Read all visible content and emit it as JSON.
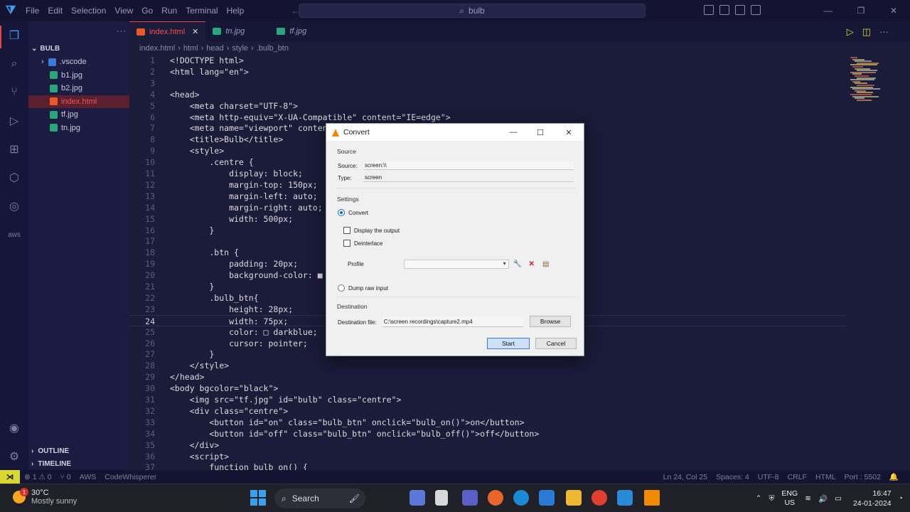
{
  "titlebar": {
    "menu": [
      "File",
      "Edit",
      "Selection",
      "View",
      "Go",
      "Run",
      "Terminal",
      "Help"
    ],
    "search_text": "bulb"
  },
  "sidebar": {
    "folder": "BULB",
    "items": [
      {
        "label": ".vscode",
        "type": "folder"
      },
      {
        "label": "b1.jpg",
        "type": "image"
      },
      {
        "label": "b2.jpg",
        "type": "image"
      },
      {
        "label": "index.html",
        "type": "html",
        "active": true
      },
      {
        "label": "tf.jpg",
        "type": "image"
      },
      {
        "label": "tn.jpg",
        "type": "image"
      }
    ],
    "outline": "OUTLINE",
    "timeline": "TIMELINE"
  },
  "tabs": [
    {
      "label": "index.html",
      "active": true
    },
    {
      "label": "tn.jpg",
      "active": false
    },
    {
      "label": "tf.jpg",
      "active": false
    }
  ],
  "breadcrumb": [
    "index.html",
    "html",
    "head",
    "style",
    ".bulb_btn"
  ],
  "editor": {
    "current_line": 24,
    "lines": [
      {
        "n": "1",
        "t": "<!DOCTYPE html>"
      },
      {
        "n": "2",
        "t": "<html lang=\"en\">"
      },
      {
        "n": "3",
        "t": ""
      },
      {
        "n": "4",
        "t": "<head>"
      },
      {
        "n": "5",
        "t": "    <meta charset=\"UTF-8\">"
      },
      {
        "n": "6",
        "t": "    <meta http-equiv=\"X-UA-Compatible\" content=\"IE=edge\">"
      },
      {
        "n": "7",
        "t": "    <meta name=\"viewport\" content="
      },
      {
        "n": "8",
        "t": "    <title>Bulb</title>"
      },
      {
        "n": "9",
        "t": "    <style>"
      },
      {
        "n": "10",
        "t": "        .centre {"
      },
      {
        "n": "11",
        "t": "            display: block;"
      },
      {
        "n": "12",
        "t": "            margin-top: 150px;"
      },
      {
        "n": "13",
        "t": "            margin-left: auto;"
      },
      {
        "n": "14",
        "t": "            margin-right: auto;"
      },
      {
        "n": "15",
        "t": "            width: 500px;"
      },
      {
        "n": "16",
        "t": "        }"
      },
      {
        "n": "17",
        "t": ""
      },
      {
        "n": "18",
        "t": "        .btn {"
      },
      {
        "n": "19",
        "t": "            padding: 20px;"
      },
      {
        "n": "20",
        "t": "            background-color: ■ gr"
      },
      {
        "n": "21",
        "t": "        }"
      },
      {
        "n": "22",
        "t": "        .bulb_btn{"
      },
      {
        "n": "23",
        "t": "            height: 28px;"
      },
      {
        "n": "24",
        "t": "            width: 75px;"
      },
      {
        "n": "25",
        "t": "            color: □ darkblue;"
      },
      {
        "n": "26",
        "t": "            cursor: pointer;"
      },
      {
        "n": "27",
        "t": "        }"
      },
      {
        "n": "28",
        "t": "    </style>"
      },
      {
        "n": "29",
        "t": "</head>"
      },
      {
        "n": "30",
        "t": "<body bgcolor=\"black\">"
      },
      {
        "n": "31",
        "t": "    <img src=\"tf.jpg\" id=\"bulb\" class=\"centre\">"
      },
      {
        "n": "32",
        "t": "    <div class=\"centre\">"
      },
      {
        "n": "33",
        "t": "        <button id=\"on\" class=\"bulb_btn\" onclick=\"bulb_on()\">on</button>"
      },
      {
        "n": "34",
        "t": "        <button id=\"off\" class=\"bulb_btn\" onclick=\"bulb_off()\">off</button>"
      },
      {
        "n": "35",
        "t": "    </div>"
      },
      {
        "n": "36",
        "t": "    <script>"
      },
      {
        "n": "37",
        "t": "        function bulb_on() {"
      }
    ]
  },
  "statusbar": {
    "left": [
      "⊗ 1 ⚠ 0",
      "⑂ 0",
      "AWS",
      "CodeWhisperer"
    ],
    "right": [
      "Ln 24, Col 25",
      "Spaces: 4",
      "UTF-8",
      "CRLF",
      "HTML",
      "Port : 5502"
    ]
  },
  "dialog": {
    "title": "Convert",
    "source_section": "Source",
    "source_label": "Source:",
    "source_value": "screen:\\\\",
    "type_label": "Type:",
    "type_value": "screen",
    "settings_section": "Settings",
    "convert_option": "Convert",
    "display_output": "Display the output",
    "deinterlace": "Deinterlace",
    "profile_label": "Profile",
    "dump_raw": "Dump raw input",
    "destination_section": "Destination",
    "destination_label": "Destination file:",
    "destination_value": "C:\\screen recordings\\capture2.mp4",
    "browse": "Browse",
    "start": "Start",
    "cancel": "Cancel"
  },
  "taskbar": {
    "weather_temp": "30°C",
    "weather_desc": "Mostly sunny",
    "weather_badge": "1",
    "search": "Search",
    "lang1": "ENG",
    "lang2": "US",
    "time": "16:47",
    "date": "24-01-2024"
  }
}
